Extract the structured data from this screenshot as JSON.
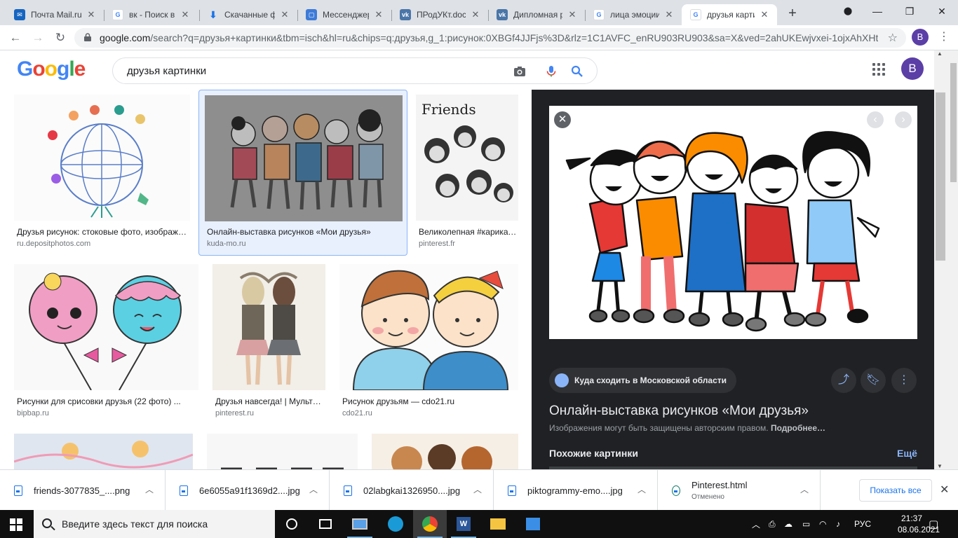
{
  "browser": {
    "tabs": [
      {
        "label": "Почта Mail.ru",
        "favicon": "mail-icon",
        "color": "#1565c0",
        "active": false
      },
      {
        "label": "вк - Поиск в Google",
        "favicon": "google-icon",
        "color": "#4285f4",
        "active": false
      },
      {
        "label": "Скачанные файлы",
        "favicon": "download-icon",
        "color": "#1a73e8",
        "active": false
      },
      {
        "label": "Мессенджер",
        "favicon": "messenger-icon",
        "color": "#3d7bd8",
        "active": false
      },
      {
        "label": "ПРодУКт.docx",
        "favicon": "vk-icon",
        "color": "#4a76a8",
        "active": false
      },
      {
        "label": "Дипломная работа",
        "favicon": "vk-icon",
        "color": "#4a76a8",
        "active": false
      },
      {
        "label": "лица эмоции",
        "favicon": "google-icon",
        "color": "#4285f4",
        "active": false
      },
      {
        "label": "друзья картинки",
        "favicon": "google-icon",
        "color": "#4285f4",
        "active": true
      }
    ],
    "url_host": "google.com",
    "url_path": "/search?q=друзья+картинки&tbm=isch&hl=ru&chips=q:друзья,g_1:рисунок:0XBGf4JJFjs%3D&rlz=1C1AVFC_enRU903RU903&sa=X&ved=2ahUKEwjvxei-1ojxAhXHt...",
    "profile_initial": "B"
  },
  "google": {
    "query": "друзья картинки",
    "avatar_initial": "B"
  },
  "results": [
    {
      "title": "Друзья рисунок: стоковые фото, изображения",
      "domain": "ru.depositphotos.com",
      "selected": false
    },
    {
      "title": "Онлайн-выставка рисунков «Мои друзья»",
      "domain": "kuda-mo.ru",
      "selected": true
    },
    {
      "title": "Великолепная #карикатура",
      "domain": "pinterest.fr",
      "selected": false
    },
    {
      "title": "Рисунки для срисовки друзья (22 фото) ...",
      "domain": "bipbap.ru",
      "selected": false
    },
    {
      "title": "Друзья навсегда! | Мультфильм",
      "domain": "pinterest.ru",
      "selected": false
    },
    {
      "title": "Рисунок друзьям — cdo21.ru",
      "domain": "cdo21.ru",
      "selected": false
    }
  ],
  "panel": {
    "source_chip": "Куда сходить в Московской области",
    "title": "Онлайн-выставка рисунков «Мои друзья»",
    "copyright": "Изображения могут быть защищены авторским правом.",
    "more_link": "Подробнее…",
    "similar_heading": "Похожие картинки",
    "similar_more": "Ещё"
  },
  "downloads": [
    {
      "name": "friends-3077835_....png",
      "status": ""
    },
    {
      "name": "6e6055a91f1369d2....jpg",
      "status": ""
    },
    {
      "name": "02labgkai1326950....jpg",
      "status": ""
    },
    {
      "name": "piktogrammy-emo....jpg",
      "status": ""
    },
    {
      "name": "Pinterest.html",
      "status": "Отменено"
    }
  ],
  "downloads_show_all": "Показать все",
  "taskbar": {
    "search_placeholder": "Введите здесь текст для поиска",
    "language": "РУС",
    "time": "21:37",
    "date": "08.06.2021"
  }
}
